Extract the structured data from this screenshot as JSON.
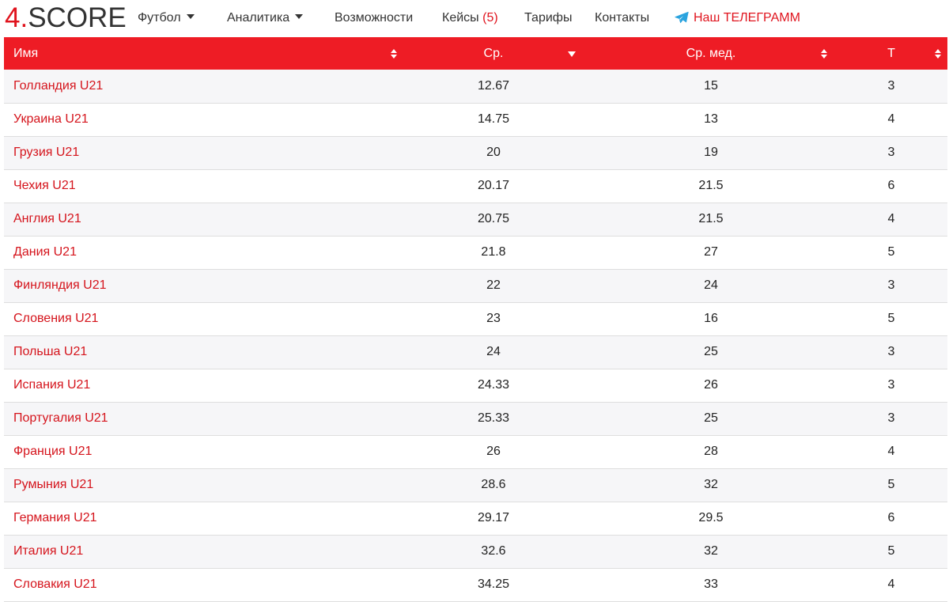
{
  "logo": {
    "digit": "4",
    "dot": ".",
    "text": "SCORE"
  },
  "nav": {
    "football": "Футбол",
    "analytics": "Аналитика",
    "features": "Возможности",
    "cases": "Кейсы",
    "cases_count": "(5)",
    "pricing": "Тарифы",
    "contacts": "Контакты",
    "telegram": "Наш ТЕЛЕГРАММ"
  },
  "table": {
    "headers": {
      "name": "Имя",
      "avg": "Ср.",
      "median": "Ср. мед.",
      "t": "Т"
    },
    "rows": [
      {
        "name": "Голландия U21",
        "avg": "12.67",
        "median": "15",
        "t": "3"
      },
      {
        "name": "Украина U21",
        "avg": "14.75",
        "median": "13",
        "t": "4"
      },
      {
        "name": "Грузия U21",
        "avg": "20",
        "median": "19",
        "t": "3"
      },
      {
        "name": "Чехия U21",
        "avg": "20.17",
        "median": "21.5",
        "t": "6"
      },
      {
        "name": "Англия U21",
        "avg": "20.75",
        "median": "21.5",
        "t": "4"
      },
      {
        "name": "Дания U21",
        "avg": "21.8",
        "median": "27",
        "t": "5"
      },
      {
        "name": "Финляндия U21",
        "avg": "22",
        "median": "24",
        "t": "3"
      },
      {
        "name": "Словения U21",
        "avg": "23",
        "median": "16",
        "t": "5"
      },
      {
        "name": "Польша U21",
        "avg": "24",
        "median": "25",
        "t": "3"
      },
      {
        "name": "Испания U21",
        "avg": "24.33",
        "median": "26",
        "t": "3"
      },
      {
        "name": "Португалия U21",
        "avg": "25.33",
        "median": "25",
        "t": "3"
      },
      {
        "name": "Франция U21",
        "avg": "26",
        "median": "28",
        "t": "4"
      },
      {
        "name": "Румыния U21",
        "avg": "28.6",
        "median": "32",
        "t": "5"
      },
      {
        "name": "Германия U21",
        "avg": "29.17",
        "median": "29.5",
        "t": "6"
      },
      {
        "name": "Италия U21",
        "avg": "32.6",
        "median": "32",
        "t": "5"
      },
      {
        "name": "Словакия U21",
        "avg": "34.25",
        "median": "33",
        "t": "4"
      }
    ]
  },
  "colors": {
    "accent": "#ee1c25",
    "link": "#d5141c",
    "stripe": "#f6f6f8"
  }
}
